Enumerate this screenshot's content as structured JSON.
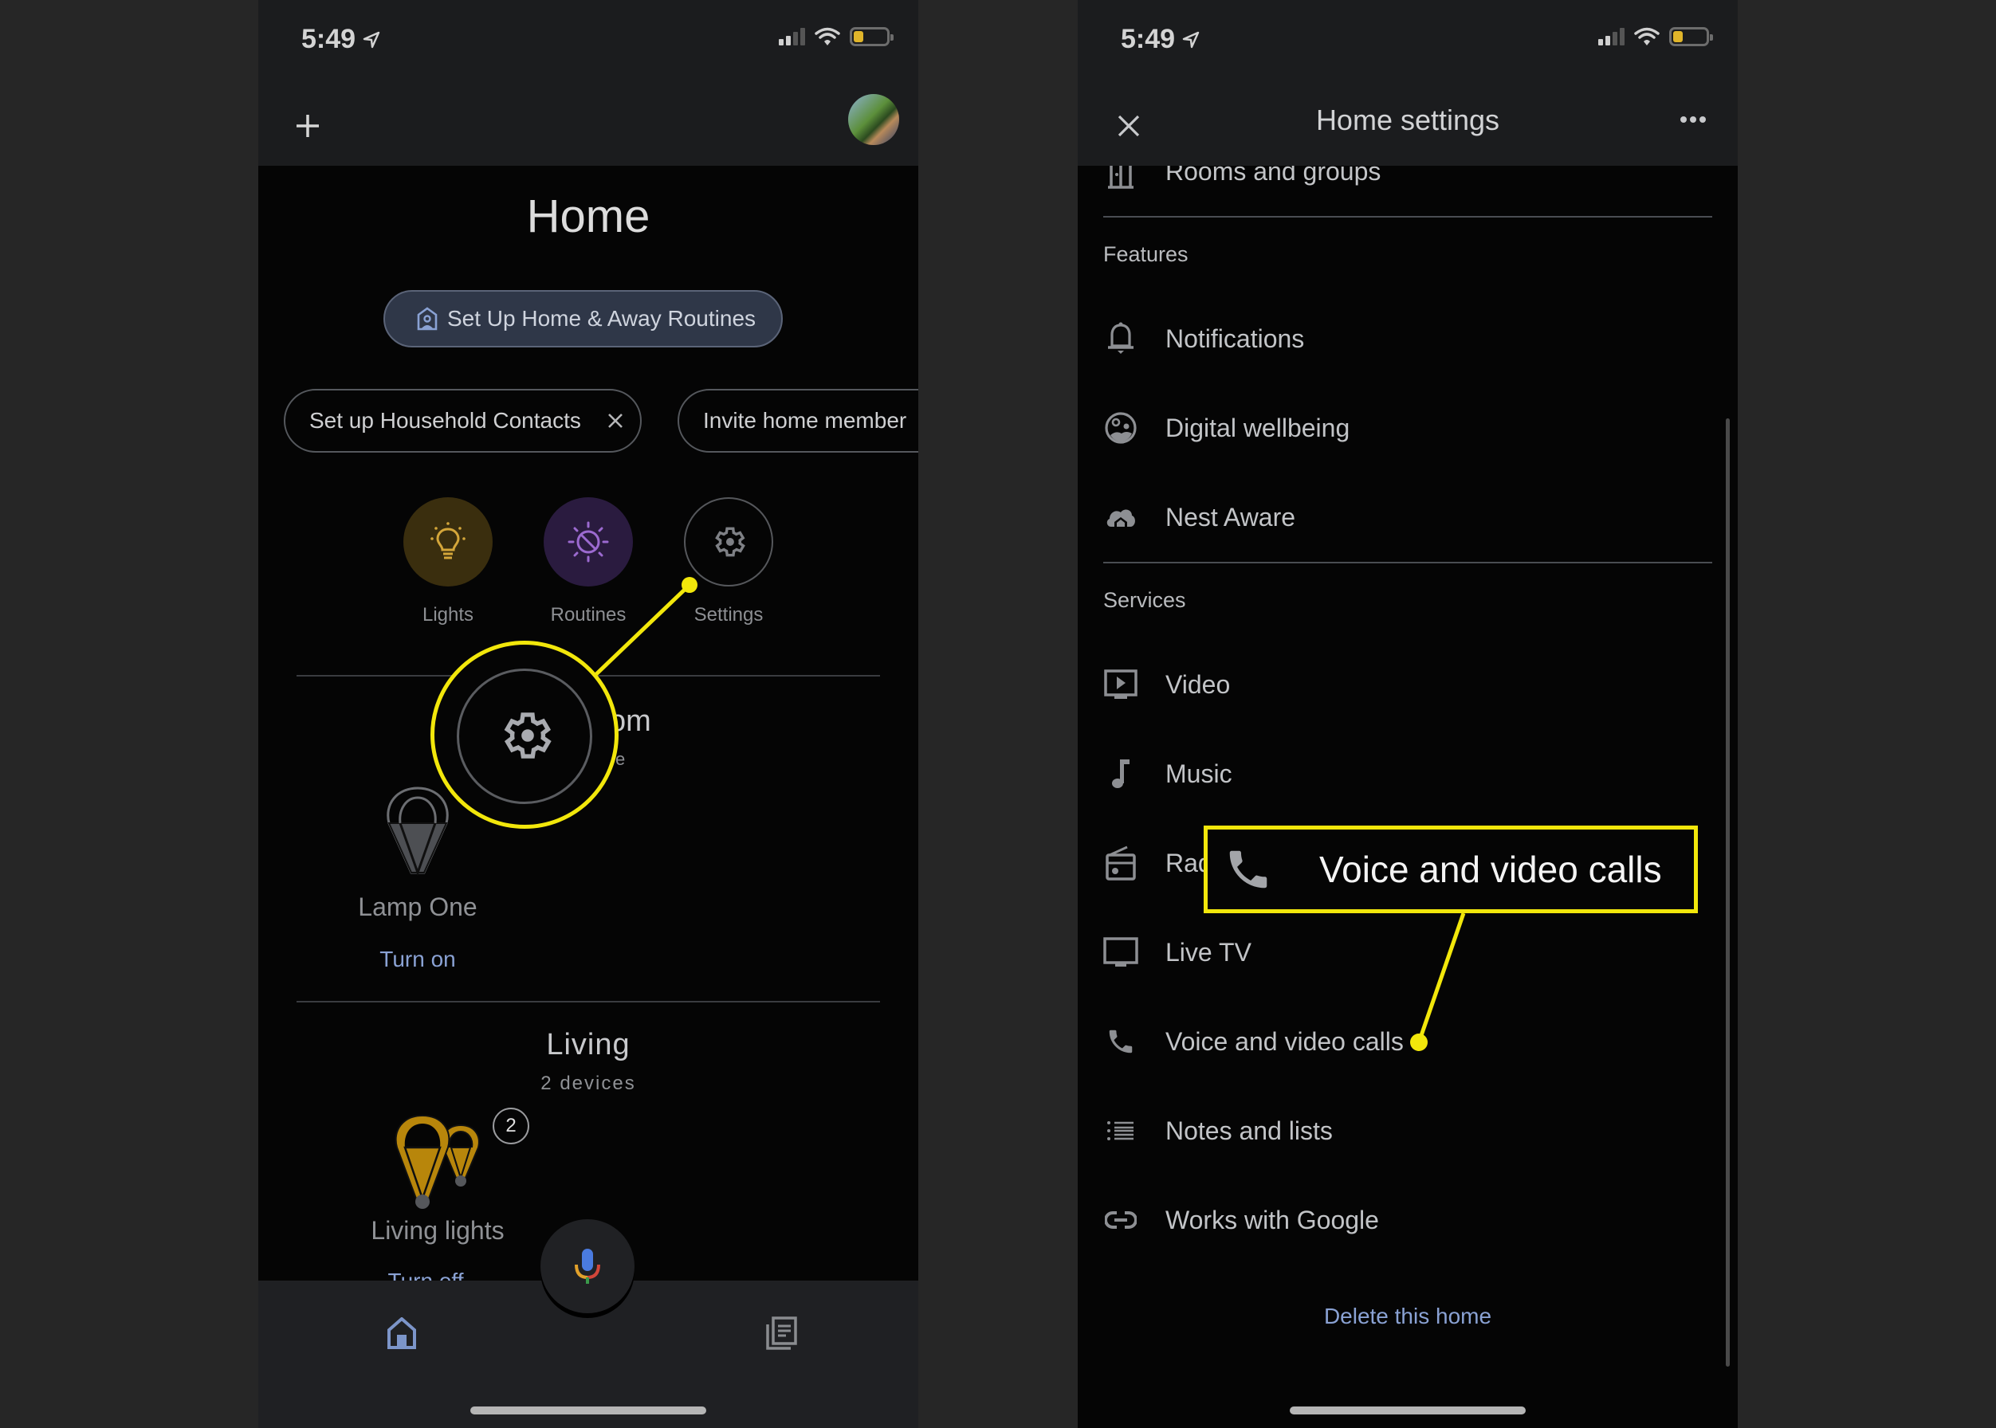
{
  "left_screen": {
    "status": {
      "time": "5:49",
      "location_icon": "location-arrow-icon",
      "signal_bars_active": 2,
      "battery_color": "#e0b52a"
    },
    "header": {
      "add_icon": "plus-icon",
      "avatar": "profile-avatar"
    },
    "title": "Home",
    "primary_chip": {
      "icon": "home-away-icon",
      "label": "Set Up Home & Away Routines"
    },
    "chips": [
      {
        "label": "Set up Household Contacts",
        "dismiss_icon": "close-icon"
      },
      {
        "label": "Invite home member"
      }
    ],
    "tiles": [
      {
        "label": "Lights",
        "icon": "lightbulb-icon",
        "bg": "#3a2e0e",
        "fg": "#d4a63a"
      },
      {
        "label": "Routines",
        "icon": "routines-sun-moon-icon",
        "bg": "#2a1b3f",
        "fg": "#9c6ad0"
      },
      {
        "label": "Settings",
        "icon": "gear-icon",
        "bg": "#050505",
        "fg": "#7e8085"
      }
    ],
    "rooms": [
      {
        "name_partial": "om",
        "subtitle_partial": "e",
        "devices": [
          {
            "name": "Lamp One",
            "action": "Turn on",
            "icon": "bulb-off-icon"
          }
        ]
      },
      {
        "name": "Living",
        "subtitle": "2 devices",
        "devices": [
          {
            "name": "Living lights",
            "action": "Turn off",
            "group_count": "2",
            "icon": "bulb-group-on-icon"
          }
        ]
      }
    ],
    "bottom_nav": {
      "items": [
        {
          "icon": "home-tab-icon",
          "active": true
        },
        {
          "icon": "feed-tab-icon",
          "active": false
        }
      ],
      "mic_icon": "assistant-mic-icon"
    },
    "annotation": {
      "highlight": "settings-gear-magnified",
      "color": "#f2e70b"
    }
  },
  "right_screen": {
    "status": {
      "time": "5:49"
    },
    "header": {
      "close_icon": "close-icon",
      "title": "Home settings",
      "more_icon": "more-horizontal-icon"
    },
    "top_item": {
      "label": "Rooms and groups",
      "icon": "rooms-icon"
    },
    "sections": [
      {
        "heading": "Features",
        "items": [
          {
            "label": "Notifications",
            "icon": "bell-icon"
          },
          {
            "label": "Digital wellbeing",
            "icon": "wellbeing-icon"
          },
          {
            "label": "Nest Aware",
            "icon": "nest-aware-cloud-icon"
          }
        ]
      },
      {
        "heading": "Services",
        "items": [
          {
            "label": "Video",
            "icon": "video-play-icon"
          },
          {
            "label": "Music",
            "icon": "music-note-icon"
          },
          {
            "label": "Radio",
            "icon": "radio-icon"
          },
          {
            "label": "Live TV",
            "icon": "tv-icon"
          },
          {
            "label": "Voice and video calls",
            "icon": "phone-icon"
          },
          {
            "label": "Notes and lists",
            "icon": "list-icon"
          },
          {
            "label": "Works with Google",
            "icon": "link-icon"
          }
        ]
      }
    ],
    "delete_link": "Delete this home",
    "callout": {
      "label": "Voice and video calls",
      "icon": "phone-icon",
      "color": "#f2e70b"
    }
  }
}
